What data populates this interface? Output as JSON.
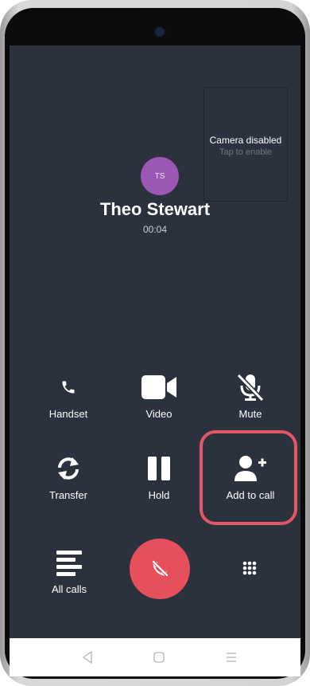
{
  "camera_preview": {
    "title": "Camera disabled",
    "subtitle": "Tap to enable"
  },
  "contact": {
    "initials": "TS",
    "name": "Theo Stewart",
    "duration": "00:04"
  },
  "controls": {
    "handset": "Handset",
    "video": "Video",
    "mute": "Mute",
    "transfer": "Transfer",
    "hold": "Hold",
    "add_to_call": "Add to call",
    "all_calls": "All calls"
  },
  "colors": {
    "background": "#2c323d",
    "end_call": "#e5505c",
    "avatar": "#9a58b4",
    "highlight": "#e15767"
  },
  "icons": [
    "phone-icon",
    "video-camera-icon",
    "mic-off-icon",
    "transfer-icon",
    "pause-icon",
    "add-user-icon",
    "list-icon",
    "call-end-icon",
    "dialpad-icon",
    "back-icon",
    "home-icon",
    "recents-icon"
  ]
}
